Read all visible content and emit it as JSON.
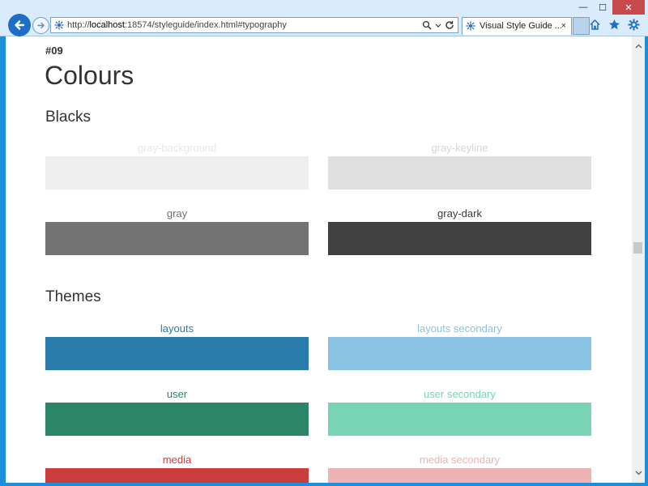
{
  "browser": {
    "url_prefix": "http://",
    "url_host": "localhost",
    "url_rest": ":18574/styleguide/index.html#typography",
    "tab_title": "Visual Style Guide ...",
    "tab_close": "×",
    "min_glyph": "—",
    "max_glyph": "☐",
    "close_glyph": "✕"
  },
  "page": {
    "section_number": "#09",
    "title": "Colours"
  },
  "groups": {
    "blacks": {
      "title": "Blacks",
      "swatches": [
        {
          "label": "gray-background",
          "color": "#eeeeee",
          "label_color": "#e8e8e8"
        },
        {
          "label": "gray-keyline",
          "color": "#e0e0e0",
          "label_color": "#d6d6d6"
        },
        {
          "label": "gray",
          "color": "#737373",
          "label_color": "#6e6e6e"
        },
        {
          "label": "gray-dark",
          "color": "#404040",
          "label_color": "#3a3a3a"
        }
      ]
    },
    "themes": {
      "title": "Themes",
      "swatches": [
        {
          "label": "layouts",
          "color": "#2a7cab",
          "label_color": "#2a7cab"
        },
        {
          "label": "layouts secondary",
          "color": "#88c3e3",
          "label_color": "#88c3e3"
        },
        {
          "label": "user",
          "color": "#2c8566",
          "label_color": "#2c8566"
        },
        {
          "label": "user secondary",
          "color": "#79d4b5",
          "label_color": "#79d4b5"
        },
        {
          "label": "media",
          "color": "#cc3e3e",
          "label_color": "#cc3e3e"
        },
        {
          "label": "media secondary",
          "color": "#efb3b3",
          "label_color": "#efb3b3"
        }
      ]
    }
  }
}
